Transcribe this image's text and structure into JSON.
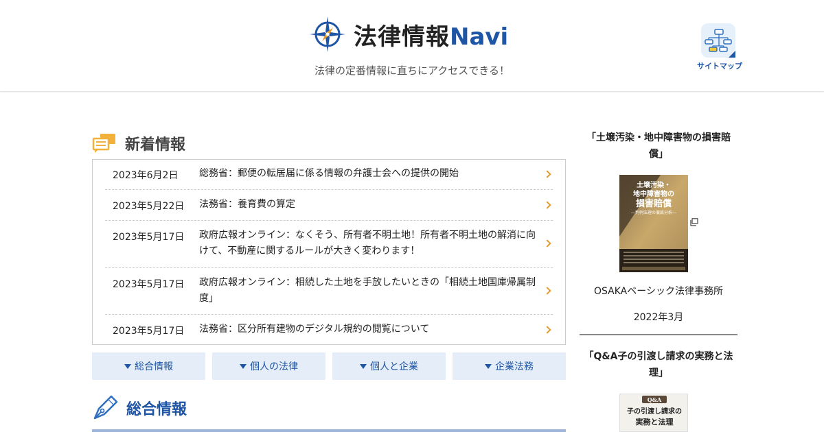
{
  "header": {
    "logo_text": "法律情報",
    "logo_navi": "Navi",
    "tagline": "法律の定番情報に直ちにアクセスできる！",
    "sitemap_label": "サイトマップ"
  },
  "news": {
    "heading": "新着情報",
    "items": [
      {
        "date": "2023年6月2日",
        "title": "総務省：郵便の転居届に係る情報の弁護士会への提供の開始"
      },
      {
        "date": "2023年5月22日",
        "title": "法務省：養育費の算定"
      },
      {
        "date": "2023年5月17日",
        "title": "政府広報オンライン：なくそう、所有者不明土地！所有者不明土地の解消に向けて、不動産に関するルールが大きく変わります！"
      },
      {
        "date": "2023年5月17日",
        "title": "政府広報オンライン：相続した土地を手放したいときの「相続土地国庫帰属制度」"
      },
      {
        "date": "2023年5月17日",
        "title": "法務省：区分所有建物のデジタル規約の閲覧について"
      }
    ]
  },
  "tabs": [
    {
      "label": "総合情報"
    },
    {
      "label": "個人の法律"
    },
    {
      "label": "個人と企業"
    },
    {
      "label": "企業法務"
    }
  ],
  "general": {
    "heading": "総合情報"
  },
  "sidebar": {
    "books": [
      {
        "title": "「土壌汚染・地中障害物の損害賠償」",
        "cover_lines": [
          "土壌汚染・",
          "地中障害物の",
          "損害賠償",
          "―判例法理の徹底分析―"
        ],
        "publisher": "OSAKAベーシック法律事務所",
        "date": "2022年3月"
      },
      {
        "title": "「Q&A子の引渡し請求の実務と法理」",
        "cover_lines": [
          "Q&A",
          "子の引渡し請求の",
          "実務と法理"
        ]
      }
    ]
  },
  "colors": {
    "brand_blue": "#1f55a5",
    "accent_orange": "#e39a2d",
    "tab_bg": "#e5eef8"
  }
}
